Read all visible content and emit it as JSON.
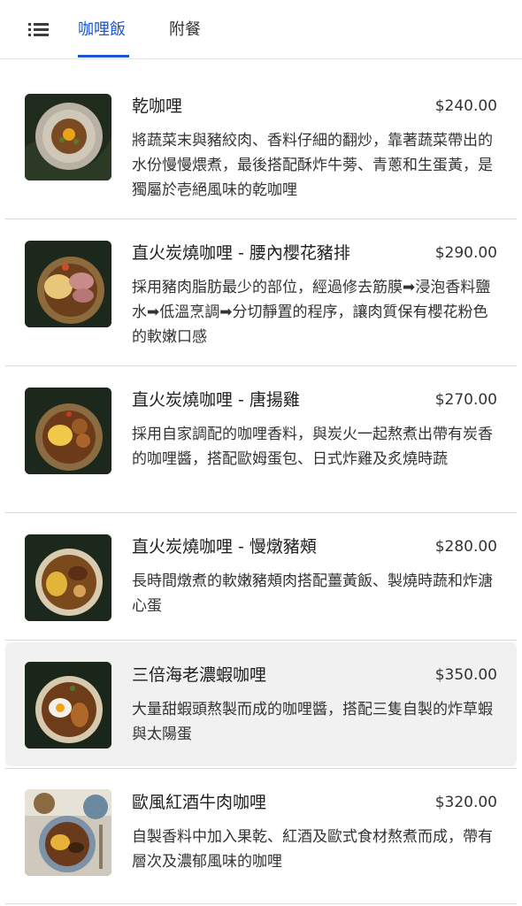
{
  "tabs": [
    {
      "label": "咖哩飯",
      "active": true
    },
    {
      "label": "附餐",
      "active": false
    }
  ],
  "colors": {
    "accent": "#1a57d6"
  },
  "items": [
    {
      "name": "乾咖哩",
      "price": "$240.00",
      "desc": "將蔬菜末與豬絞肉、香料仔細的翻炒，靠著蔬菜帶出的水份慢慢煨煮，最後搭配酥炸牛蒡、青蔥和生蛋黃，是獨屬於壱絕風味的乾咖哩"
    },
    {
      "name": "直火炭燒咖哩 - 腰內櫻花豬排",
      "price": "$290.00",
      "desc": "採用豬肉脂肪最少的部位，經過修去筋膜➡浸泡香料鹽水➡低溫烹調➡分切靜置的程序，讓肉質保有櫻花粉色的軟嫩口感"
    },
    {
      "name": "直火炭燒咖哩 - 唐揚雞",
      "price": "$270.00",
      "desc": "採用自家調配的咖哩香料，與炭火一起熬煮出帶有炭香的咖哩醬，搭配歐姆蛋包、日式炸雞及炙燒時蔬"
    },
    {
      "name": "直火炭燒咖哩 - 慢燉豬頰",
      "price": "$280.00",
      "desc": "長時間燉煮的軟嫩豬頰肉搭配薑黃飯、製燒時蔬和炸溏心蛋"
    },
    {
      "name": "三倍海老濃蝦咖哩",
      "price": "$350.00",
      "desc": "大量甜蝦頭熬製而成的咖哩醬，搭配三隻自製的炸草蝦與太陽蛋"
    },
    {
      "name": "歐風紅酒牛肉咖哩",
      "price": "$320.00",
      "desc": "自製香料中加入果乾、紅酒及歐式食材熬煮而成，帶有層次及濃郁風味的咖哩"
    }
  ]
}
